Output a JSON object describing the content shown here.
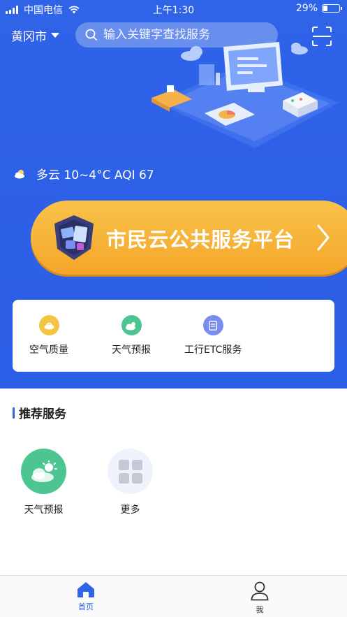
{
  "status_bar": {
    "carrier": "中国电信",
    "time": "上午1:30",
    "battery": "29%",
    "battery_level": 0.29
  },
  "header": {
    "city": "黄冈市",
    "search_placeholder": "输入关键字查找服务",
    "scan_icon": "scan-icon"
  },
  "weather": {
    "icon": "partly-cloudy-icon",
    "text": "多云 10~4°C AQI 67"
  },
  "banner": {
    "title": "市民云公共服务平台"
  },
  "quick_services": [
    {
      "label": "空气质量",
      "icon": "air-quality-icon",
      "color": "#f4c542"
    },
    {
      "label": "天气预报",
      "icon": "weather-icon",
      "color": "#4cc593"
    },
    {
      "label": "工行ETC服务",
      "icon": "etc-icon",
      "color": "#7b8cf0"
    }
  ],
  "recommended": {
    "title": "推荐服务",
    "items": [
      {
        "label": "天气预报",
        "icon": "weather-icon",
        "color": "#4cc593"
      },
      {
        "label": "更多",
        "icon": "more-grid-icon",
        "color": "#eef3fb"
      }
    ]
  },
  "tabbar": {
    "items": [
      {
        "label": "首页",
        "icon": "home-icon",
        "active": true
      },
      {
        "label": "我",
        "icon": "profile-icon",
        "active": false
      }
    ],
    "active_color": "#2f63e8",
    "inactive_color": "#333333"
  }
}
